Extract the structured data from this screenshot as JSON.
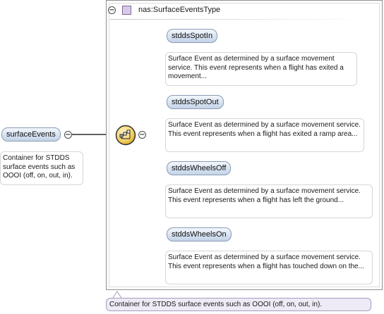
{
  "type": {
    "name": "nas:SurfaceEventsType",
    "toggle": "−",
    "icon": "complex-type-icon"
  },
  "root": {
    "name": "surfaceEvents",
    "toggle": "−",
    "annotation": "Container for STDDS surface events such as OOOI (off, on, out, in)."
  },
  "sequence": {
    "icon": "sequence-compositor-icon",
    "toggle": "−"
  },
  "elements": [
    {
      "name": "stddsSpotIn",
      "annotation": "Surface Event as determined by a surface movement service. This event represents when a flight has exited a movement..."
    },
    {
      "name": "stddsSpotOut",
      "annotation": "Surface Event as determined by a surface movement service. This event represents when a flight has exited a ramp area..."
    },
    {
      "name": "stddsWheelsOff",
      "annotation": "Surface Event as determined by a surface movement service. This event represents when a flight has left the ground..."
    },
    {
      "name": "stddsWheelsOn",
      "annotation": "Surface Event as determined by a surface movement service. This event represents when a flight has touched down on the..."
    }
  ],
  "footer_annotation": "Container for STDDS surface events such as OOOI (off, on, out, in)."
}
